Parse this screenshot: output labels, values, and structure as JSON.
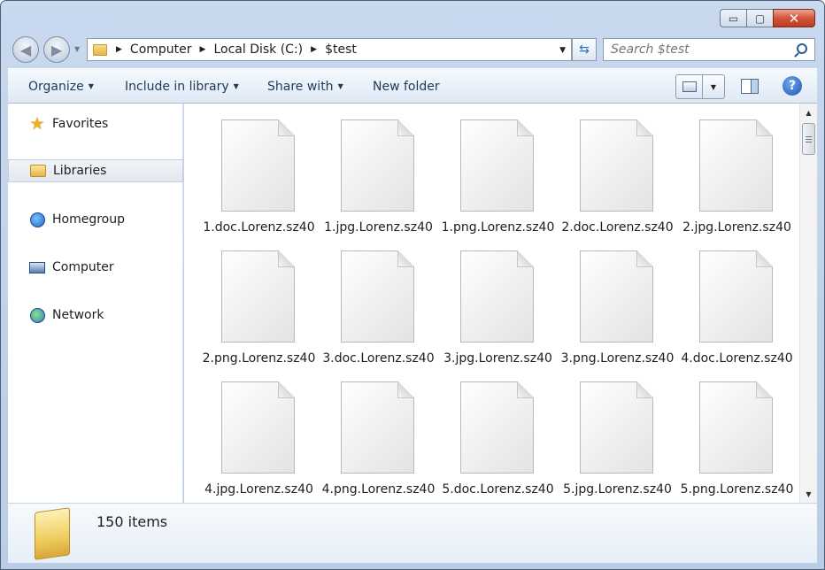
{
  "window": {
    "minimize_glyph": "▭",
    "maximize_glyph": "▢",
    "close_glyph": "✕"
  },
  "address_bar": {
    "breadcrumbs": [
      "Computer",
      "Local Disk (C:)",
      "$test"
    ],
    "back_glyph": "◀",
    "forward_glyph": "▶",
    "refresh_glyph": "⇆"
  },
  "search": {
    "placeholder": "Search $test"
  },
  "toolbar": {
    "organize": "Organize",
    "include_in_library": "Include in library",
    "share_with": "Share with",
    "new_folder": "New folder",
    "help_glyph": "?"
  },
  "nav": {
    "favorites": "Favorites",
    "libraries": "Libraries",
    "homegroup": "Homegroup",
    "computer": "Computer",
    "network": "Network"
  },
  "files": [
    "1.doc.Lorenz.sz40",
    "1.jpg.Lorenz.sz40",
    "1.png.Lorenz.sz40",
    "2.doc.Lorenz.sz40",
    "2.jpg.Lorenz.sz40",
    "2.png.Lorenz.sz40",
    "3.doc.Lorenz.sz40",
    "3.jpg.Lorenz.sz40",
    "3.png.Lorenz.sz40",
    "4.doc.Lorenz.sz40",
    "4.jpg.Lorenz.sz40",
    "4.png.Lorenz.sz40",
    "5.doc.Lorenz.sz40",
    "5.jpg.Lorenz.sz40",
    "5.png.Lorenz.sz40"
  ],
  "status": {
    "item_count": "150 items"
  },
  "icons": {
    "favorites": "star-icon",
    "libraries": "libraries-icon",
    "homegroup": "homegroup-icon",
    "computer": "computer-icon",
    "network": "network-icon",
    "file": "blank-document-icon",
    "folder": "folder-icon"
  }
}
